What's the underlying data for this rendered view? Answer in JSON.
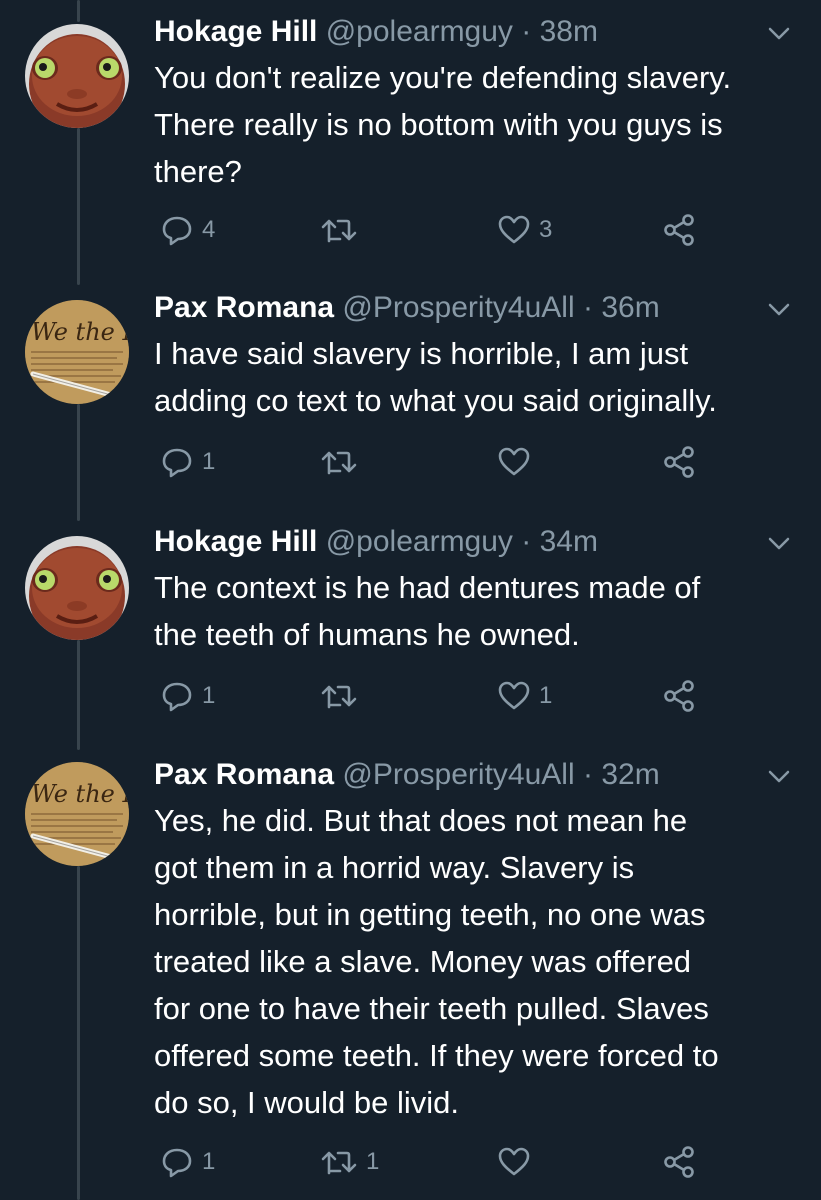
{
  "colors": {
    "background": "#15202b",
    "primary_text": "#ffffff",
    "secondary_text": "#8899a6",
    "thread_line": "#38444d"
  },
  "tweets": [
    {
      "display_name": "Hokage Hill",
      "handle": "@polearmguy",
      "separator": "·",
      "time": "38m",
      "avatar": "cartoon-face-avatar",
      "text": "You don't realize you're defending slavery.\nThere really is no bottom with you guys is\nthere?",
      "reply_count": "4",
      "retweet_count": "",
      "like_count": "3"
    },
    {
      "display_name": "Pax Romana",
      "handle": "@Prosperity4uAll",
      "separator": "·",
      "time": "36m",
      "avatar": "constitution-document-avatar",
      "text": "I have said slavery is horrible, I am just\nadding co text to what you said originally.",
      "reply_count": "1",
      "retweet_count": "",
      "like_count": ""
    },
    {
      "display_name": "Hokage Hill",
      "handle": "@polearmguy",
      "separator": "·",
      "time": "34m",
      "avatar": "cartoon-face-avatar",
      "text": "The context is he had dentures made of\nthe teeth of humans he owned.",
      "reply_count": "1",
      "retweet_count": "",
      "like_count": "1"
    },
    {
      "display_name": "Pax Romana",
      "handle": "@Prosperity4uAll",
      "separator": "·",
      "time": "32m",
      "avatar": "constitution-document-avatar",
      "text": "Yes, he did. But that does not mean he\ngot them in a horrid way. Slavery is\nhorrible, but in getting teeth, no one was\ntreated like a slave. Money was offered\nfor one to have their teeth pulled. Slaves\noffered some teeth. If they were forced to\ndo so, I would be livid.",
      "reply_count": "1",
      "retweet_count": "1",
      "like_count": ""
    }
  ],
  "icons": {
    "reply": "reply-icon",
    "retweet": "retweet-icon",
    "like": "heart-icon",
    "share": "share-icon",
    "caret": "chevron-down-icon"
  }
}
